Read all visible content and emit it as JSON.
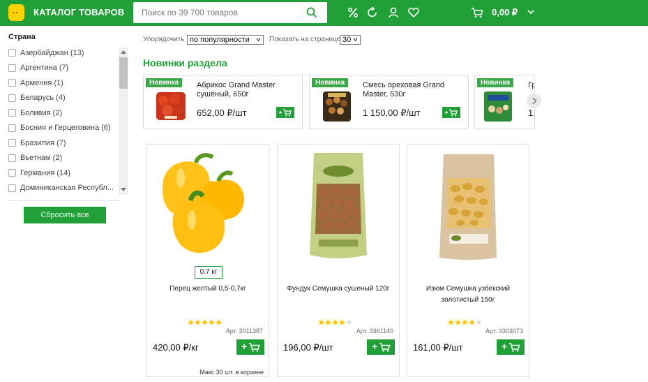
{
  "header": {
    "catalog_label": "КАТАЛОГ ТОВАРОВ",
    "search_placeholder": "Поиск по 39 700 товаров",
    "cart_total": "0,00 ₽"
  },
  "filter": {
    "title": "Страна",
    "items": [
      "Азербайджан (13)",
      "Аргентина (7)",
      "Армения (1)",
      "Беларусь (4)",
      "Боливия (2)",
      "Босния и Герцеговина (6)",
      "Бразилия (7)",
      "Вьетнам (2)",
      "Германия (14)",
      "Доминиканская Республ..."
    ],
    "reset_label": "Сбросить все"
  },
  "sort": {
    "label": "Упорядочить",
    "value": "по популярности",
    "per_page_label": "Показать на странице",
    "per_page_value": "30"
  },
  "new_section": {
    "title": "Новинки раздела",
    "badge": "Новинка",
    "items": [
      {
        "name": "Абрикос Grand Master сушеный, 650г",
        "price": "652,00 ₽/шт"
      },
      {
        "name": "Смесь ореховая Grand Master, 530г",
        "price": "1 150,00 ₽/шт"
      },
      {
        "name": "Гр...",
        "price": "1..."
      }
    ]
  },
  "products": [
    {
      "weight": "0.7 кг",
      "name": "Перец желтый 0,5-0,7кг",
      "rating": 5,
      "art": "Арт. 2011387",
      "price": "420,00 ₽/кг",
      "cart_label": "+",
      "note": "Макс 30 шт. в корзине"
    },
    {
      "weight": "",
      "name": "Фундук Семушка сушеный 120г",
      "rating": 4,
      "art": "Арт. 3361140",
      "price": "196,00 ₽/шт",
      "cart_label": "+",
      "note": ""
    },
    {
      "weight": "",
      "name": "Изюм Семушка узбекский золотистый 150г",
      "rating": 4,
      "art": "Арт. 3303073",
      "price": "161,00 ₽/шт",
      "cart_label": "+",
      "note": ""
    }
  ],
  "colors": {
    "brand": "#21a038",
    "star": "#ffc400",
    "star_empty": "#dddddd"
  }
}
